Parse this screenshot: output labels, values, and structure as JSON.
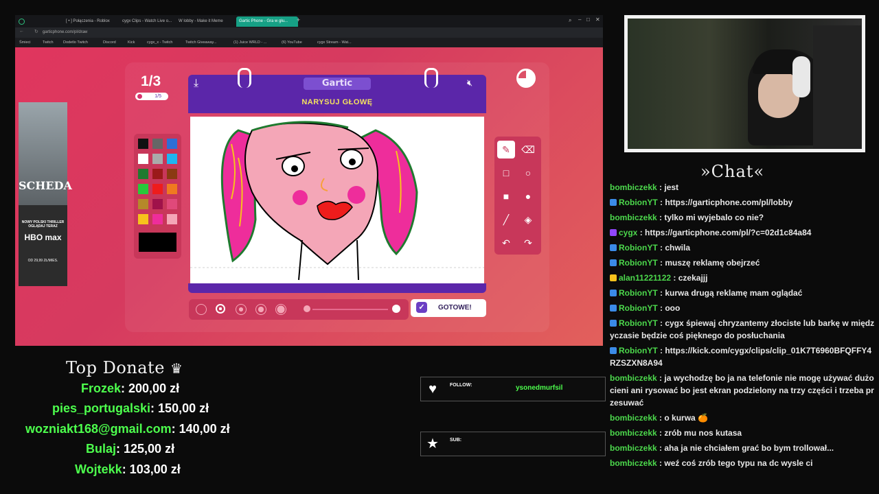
{
  "browser": {
    "tabs": [
      {
        "label": "[ • ] Połączenia - Roblox",
        "active": false
      },
      {
        "label": "cygx Clips - Watch Live o...",
        "active": false
      },
      {
        "label": "W lobby - Make it Meme",
        "active": false
      },
      {
        "label": "Gartic Phone - Gra w głu...",
        "active": true
      }
    ],
    "url": "garticphone.com/pl/draw",
    "bookmarks": [
      "Śmieci",
      "Twitch",
      "Dodetlo Twitch",
      "Discord",
      "Kick",
      "cygx_x - Twitch",
      "Twitch Giveaway...",
      "(1) Juice WRLD - ...",
      "(6) YouTube",
      "cygx Stream - Wat..."
    ]
  },
  "ad": {
    "title": "SCHEDA",
    "tagline": "NOWY POLSKI THRILLER OGLĄDAJ TERAZ",
    "brand": "HBO max",
    "price": "OD 29,99 ZŁ/MIES."
  },
  "game": {
    "round": "1/3",
    "subround": "1/5",
    "logo": "Gartic",
    "instruction": "NARYSUJ GŁOWĘ",
    "done_label": "GOTOWE!",
    "palette": [
      "#111111",
      "#666666",
      "#2d6fd6",
      "#ffffff",
      "#aaaaaa",
      "#1fb5f0",
      "#1f7a2f",
      "#9b1a1a",
      "#8a3a12",
      "#28c83a",
      "#ee1c1c",
      "#f07a20",
      "#b5882a",
      "#a0124a",
      "#e0497a",
      "#f7c21c",
      "#ee2d9b",
      "#f4a6b7"
    ],
    "selected_color": "#000000"
  },
  "chat": {
    "title": "»Chat«",
    "messages": [
      {
        "user": "bombiczekk",
        "text": "jest",
        "badge": "none"
      },
      {
        "user": "RobionYT",
        "text": "https://garticphone.com/pl/lobby",
        "badge": "blue"
      },
      {
        "user": "bombiczekk",
        "text": "tylko mi wyjebalo co nie?",
        "badge": "none"
      },
      {
        "user": "cygx",
        "text": "https://garticphone.com/pl/?c=02d1c84a84",
        "badge": "mic"
      },
      {
        "user": "RobionYT",
        "text": "chwila",
        "badge": "blue"
      },
      {
        "user": "RobionYT",
        "text": "muszę reklamę obejrzeć",
        "badge": "blue"
      },
      {
        "user": "alan11221122",
        "text": "czekajjj",
        "badge": "crown"
      },
      {
        "user": "RobionYT",
        "text": "kurwa drugą reklamę mam oglądać",
        "badge": "blue"
      },
      {
        "user": "RobionYT",
        "text": "ooo",
        "badge": "blue"
      },
      {
        "user": "RobionYT",
        "text": "cygx śpiewaj chryzantemy złociste lub barkę w międzyczasie będzie coś pięknego do posłuchania",
        "badge": "blue"
      },
      {
        "user": "RobionYT",
        "text": "https://kick.com/cygx/clips/clip_01K7T6960BFQFFY4RZSZXN8A94",
        "badge": "blue"
      },
      {
        "user": "bombiczekk",
        "text": "ja wychodzę bo ja na telefonie nie mogę używać dużo cieni ani rysować bo jest ekran podzielony na trzy części i trzeba przesuwać",
        "badge": "none"
      },
      {
        "user": "bombiczekk",
        "text": "o kurwa 🍊",
        "badge": "none"
      },
      {
        "user": "bombiczekk",
        "text": "zrób mu nos kutasa",
        "badge": "none"
      },
      {
        "user": "bombiczekk",
        "text": "aha ja nie chciałem grać bo bym trollował...",
        "badge": "none"
      },
      {
        "user": "bombiczekk",
        "text": "weź coś zrób tego typu na dc wysle ci",
        "badge": "none"
      }
    ]
  },
  "donate": {
    "title": "Top Donate",
    "entries": [
      {
        "name": "Frozek",
        "amount": ": 200,00 zł"
      },
      {
        "name": "pies_portugalski",
        "amount": ": 150,00 zł"
      },
      {
        "name": "wozniakt168@gmail.com",
        "amount": ": 140,00 zł"
      },
      {
        "name": "Bulaj",
        "amount": ": 125,00 zł"
      },
      {
        "name": "Wojtekk",
        "amount": ": 103,00 zł"
      }
    ]
  },
  "follow": {
    "label": "FOLLOW:",
    "value": "ysonedmurfsil"
  },
  "sub": {
    "label": "SUB:",
    "value": ""
  }
}
